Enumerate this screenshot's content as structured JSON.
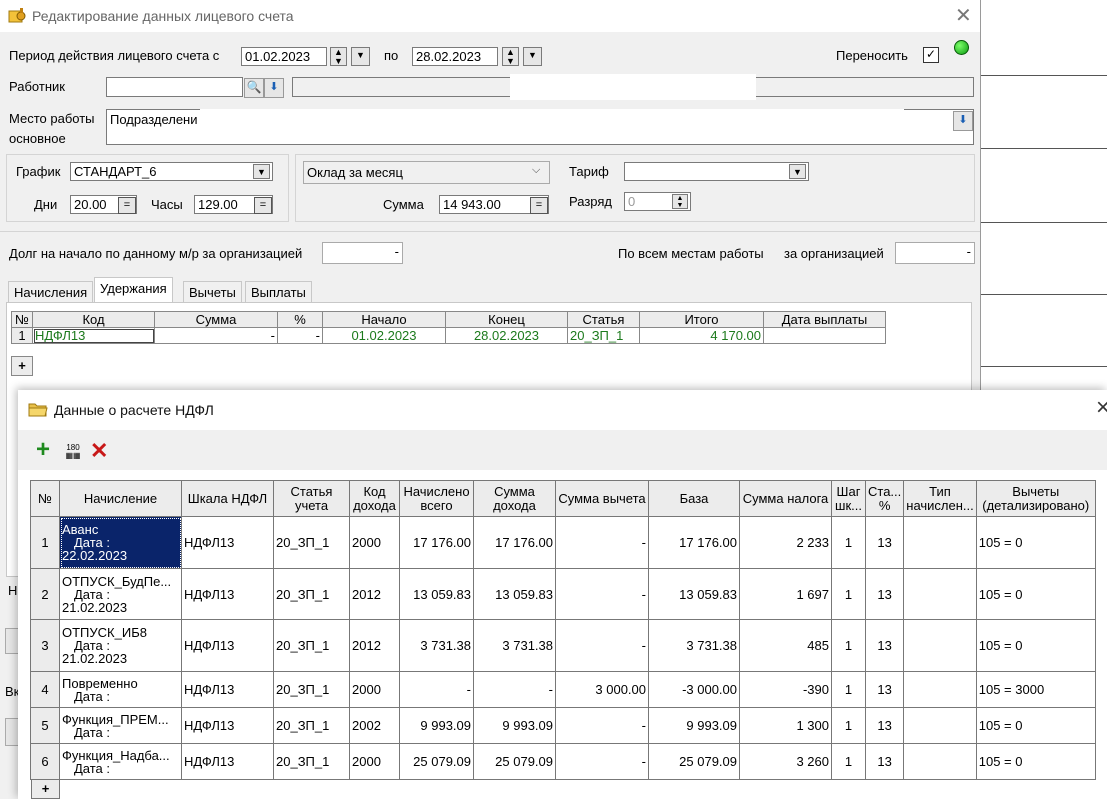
{
  "back_window": {
    "title": "Редактирование данных лицевого счета",
    "period_label": "Период действия лицевого счета с",
    "period_from": "01.02.2023",
    "period_to_label": "по",
    "period_to": "28.02.2023",
    "transfer_label": "Переносить",
    "worker_label": "Работник",
    "workplace_label_1": "Место работы",
    "workplace_label_2": "основное",
    "workplace_value": "Подразделени",
    "schedule_label": "График",
    "schedule_value": "СТАНДАРТ_6",
    "days_label": "Дни",
    "days_value": "20.00",
    "hours_label": "Часы",
    "hours_value": "129.00",
    "pay_type_value": "Оклад за месяц",
    "sum_label": "Сумма",
    "sum_value": "14 943.00",
    "tariff_label": "Тариф",
    "grade_label": "Разряд",
    "grade_value": "0",
    "debt_label": "Долг на начало по данному м/р за организацией",
    "debt_value": "-",
    "all_places_label": "По всем местам работы",
    "org_label": "за организацией",
    "org_value": "-",
    "tabs": [
      "Начисления",
      "Удержания",
      "Вычеты",
      "Выплаты"
    ],
    "grid_headers": [
      "№",
      "Код",
      "Сумма",
      "%",
      "Начало",
      "Конец",
      "Статья",
      "Итого",
      "Дата выплаты"
    ],
    "grid_row": {
      "n": "1",
      "code": "НДФЛ13",
      "sum": "-",
      "pct": "-",
      "start": "01.02.2023",
      "end": "28.02.2023",
      "article": "20_ЗП_1",
      "total": "4 170.00",
      "paydate": ""
    },
    "add_row": "+",
    "side_letters": [
      "Н",
      "Вк"
    ]
  },
  "front_window": {
    "title": "Данные о расчете НДФЛ",
    "close": "×",
    "toolbar_add": "+",
    "toolbar_calc": "180",
    "toolbar_delete": "✕",
    "headers": [
      "№",
      "Начисление",
      "Шкала НДФЛ",
      "Статья учета",
      "Код дохода",
      "Начислено всего",
      "Сумма дохода",
      "Сумма вычета",
      "База",
      "Сумма налога",
      "Шаг шк...",
      "Ста... %",
      "Тип начислен...",
      "Вычеты (детализировано)"
    ],
    "rows": [
      {
        "n": "1",
        "name": "Аванс",
        "date_line": "Дата :",
        "date": "22.02.2023",
        "scale": "НДФЛ13",
        "article": "20_ЗП_1",
        "code": "2000",
        "accrued": "17 176.00",
        "income": "17 176.00",
        "deduction": "-",
        "base": "17 176.00",
        "tax": "2 233",
        "step": "1",
        "rate": "13",
        "type": "",
        "deductions": "105 = 0"
      },
      {
        "n": "2",
        "name": "ОТПУСК_БудПе...",
        "date_line": "Дата :",
        "date": "21.02.2023",
        "scale": "НДФЛ13",
        "article": "20_ЗП_1",
        "code": "2012",
        "accrued": "13 059.83",
        "income": "13 059.83",
        "deduction": "-",
        "base": "13 059.83",
        "tax": "1 697",
        "step": "1",
        "rate": "13",
        "type": "",
        "deductions": "105 = 0"
      },
      {
        "n": "3",
        "name": "ОТПУСК_ИБ8",
        "date_line": "Дата :",
        "date": "21.02.2023",
        "scale": "НДФЛ13",
        "article": "20_ЗП_1",
        "code": "2012",
        "accrued": "3 731.38",
        "income": "3 731.38",
        "deduction": "-",
        "base": "3 731.38",
        "tax": "485",
        "step": "1",
        "rate": "13",
        "type": "",
        "deductions": "105 = 0"
      },
      {
        "n": "4",
        "name": "Повременно",
        "date_line": "Дата :",
        "date": "",
        "scale": "НДФЛ13",
        "article": "20_ЗП_1",
        "code": "2000",
        "accrued": "-",
        "income": "-",
        "deduction": "3 000.00",
        "base": "-3 000.00",
        "tax": "-390",
        "step": "1",
        "rate": "13",
        "type": "",
        "deductions": "105 = 3000"
      },
      {
        "n": "5",
        "name": "Функция_ПРЕМ...",
        "date_line": "Дата :",
        "date": "",
        "scale": "НДФЛ13",
        "article": "20_ЗП_1",
        "code": "2002",
        "accrued": "9 993.09",
        "income": "9 993.09",
        "deduction": "-",
        "base": "9 993.09",
        "tax": "1 300",
        "step": "1",
        "rate": "13",
        "type": "",
        "deductions": "105 = 0"
      },
      {
        "n": "6",
        "name": "Функция_Надба...",
        "date_line": "Дата :",
        "date": "",
        "scale": "НДФЛ13",
        "article": "20_ЗП_1",
        "code": "2000",
        "accrued": "25 079.09",
        "income": "25 079.09",
        "deduction": "-",
        "base": "25 079.09",
        "tax": "3 260",
        "step": "1",
        "rate": "13",
        "type": "",
        "deductions": "105 = 0"
      }
    ],
    "add_row": "+"
  }
}
